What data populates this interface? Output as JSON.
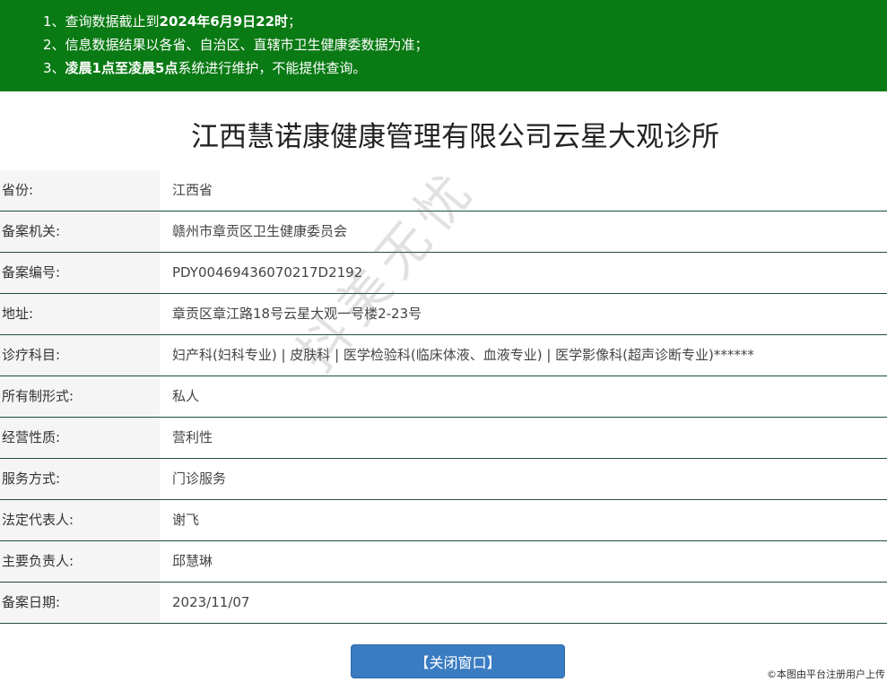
{
  "notice": {
    "line1_prefix": "1、查询数据截止到",
    "line1_bold": "2024年6月9日22时",
    "line1_suffix": "；",
    "line2": "2、信息数据结果以各省、自治区、直辖市卫生健康委数据为准；",
    "line3_prefix": "3、",
    "line3_bold": "凌晨1点至凌晨5点",
    "line3_suffix": "系统进行维护，不能提供查询。"
  },
  "title": "江西慧诺康健康管理有限公司云星大观诊所",
  "rows": [
    {
      "label": "省份:",
      "value": "江西省"
    },
    {
      "label": "备案机关:",
      "value": "赣州市章贡区卫生健康委员会"
    },
    {
      "label": "备案编号:",
      "value": "PDY00469436070217D2192"
    },
    {
      "label": "地址:",
      "value": "章贡区章江路18号云星大观一号楼2-23号"
    },
    {
      "label": "诊疗科目:",
      "value": "妇产科(妇科专业) | 皮肤科 | 医学检验科(临床体液、血液专业) | 医学影像科(超声诊断专业)******"
    },
    {
      "label": "所有制形式:",
      "value": "私人"
    },
    {
      "label": "经营性质:",
      "value": "营利性"
    },
    {
      "label": "服务方式:",
      "value": "门诊服务"
    },
    {
      "label": "法定代表人:",
      "value": "谢飞"
    },
    {
      "label": "主要负责人:",
      "value": "邱慧琳"
    },
    {
      "label": "备案日期:",
      "value": "2023/11/07"
    }
  ],
  "close_button": "【关闭窗口】",
  "watermark": "抖美无忧",
  "footer_note": "©本图由平台注册用户上传",
  "colors": {
    "banner": "#0a7a14",
    "button": "#3a7cc2",
    "row_border": "#1e4e3a"
  }
}
